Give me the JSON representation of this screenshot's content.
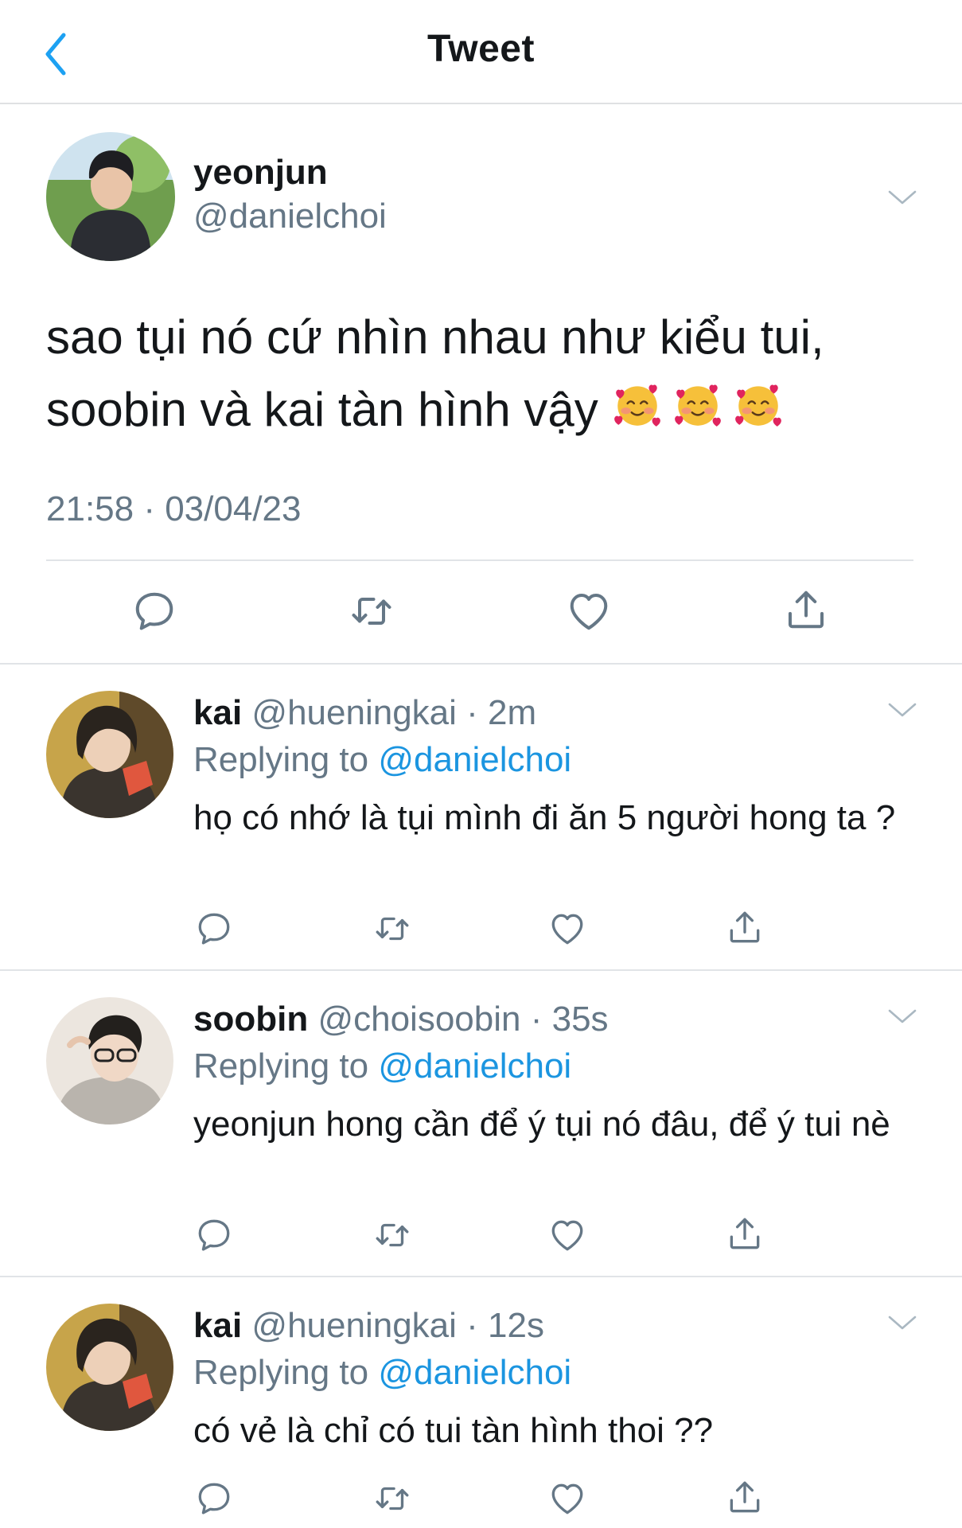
{
  "header": {
    "title": "Tweet",
    "back_icon": "chevron-left-icon",
    "accent_color": "#1da1f2"
  },
  "main_tweet": {
    "name": "yeonjun",
    "handle": "@danielchoi",
    "text": "sao tụi nó cứ nhìn nhau như kiểu tui, soobin và kai tàn hình vậy",
    "emojis": [
      "smiling-face-with-hearts",
      "smiling-face-with-hearts",
      "smiling-face-with-hearts"
    ],
    "timestamp": "21:58 · 03/04/23",
    "actions": [
      "reply-icon",
      "retweet-icon",
      "like-icon",
      "share-icon"
    ]
  },
  "replies": [
    {
      "name": "kai",
      "handle": "@hueningkai",
      "time": "· 2m",
      "replying_label": "Replying to",
      "replying_to": "@danielchoi",
      "text": "họ có nhớ là tụi mình đi ăn 5 người hong ta ?"
    },
    {
      "name": "soobin",
      "handle": "@choisoobin",
      "time": "· 35s",
      "replying_label": "Replying to",
      "replying_to": "@danielchoi",
      "text": "yeonjun hong cần để ý tụi nó đâu, để ý tui nè"
    },
    {
      "name": "kai",
      "handle": "@hueningkai",
      "time": "· 12s",
      "replying_label": "Replying to",
      "replying_to": "@danielchoi",
      "text": "có vẻ là chỉ có tui tàn hình thoi ??"
    }
  ],
  "colors": {
    "text": "#14171a",
    "secondary": "#657786",
    "link": "#1b95e0",
    "divider": "#e1e4e7"
  }
}
